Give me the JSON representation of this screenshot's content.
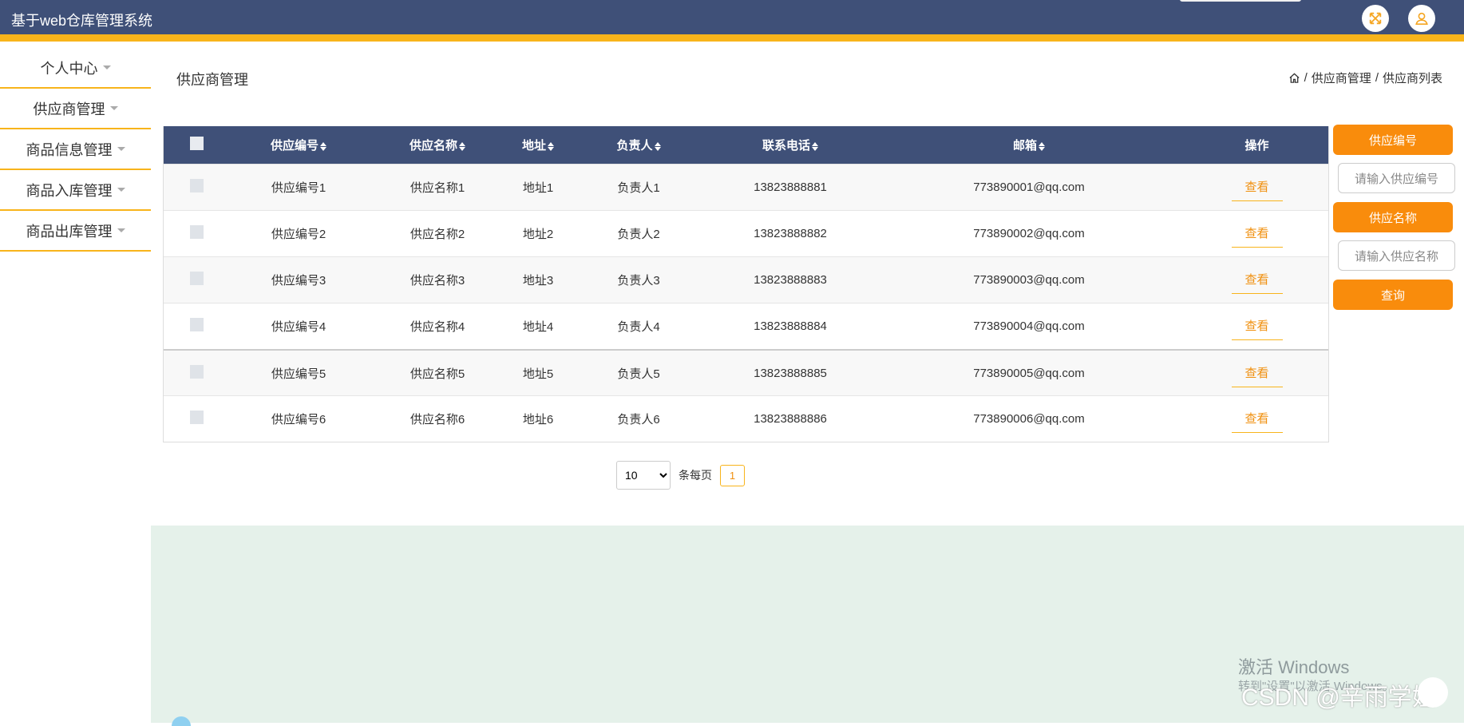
{
  "app": {
    "title": "基于web仓库管理系统"
  },
  "sidebar": {
    "items": [
      {
        "label": "个人中心"
      },
      {
        "label": "供应商管理"
      },
      {
        "label": "商品信息管理"
      },
      {
        "label": "商品入库管理"
      },
      {
        "label": "商品出库管理"
      }
    ]
  },
  "page": {
    "title": "供应商管理"
  },
  "breadcrumb": {
    "level1": "供应商管理",
    "level2": "供应商列表",
    "separator": "/"
  },
  "table": {
    "headers": [
      "供应编号",
      "供应名称",
      "地址",
      "负责人",
      "联系电话",
      "邮箱",
      "操作"
    ],
    "rows": [
      [
        "供应编号1",
        "供应名称1",
        "地址1",
        "负责人1",
        "13823888881",
        "773890001@qq.com",
        "查看"
      ],
      [
        "供应编号2",
        "供应名称2",
        "地址2",
        "负责人2",
        "13823888882",
        "773890002@qq.com",
        "查看"
      ],
      [
        "供应编号3",
        "供应名称3",
        "地址3",
        "负责人3",
        "13823888883",
        "773890003@qq.com",
        "查看"
      ],
      [
        "供应编号4",
        "供应名称4",
        "地址4",
        "负责人4",
        "13823888884",
        "773890004@qq.com",
        "查看"
      ],
      [
        "供应编号5",
        "供应名称5",
        "地址5",
        "负责人5",
        "13823888885",
        "773890005@qq.com",
        "查看"
      ],
      [
        "供应编号6",
        "供应名称6",
        "地址6",
        "负责人6",
        "13823888886",
        "773890006@qq.com",
        "查看"
      ]
    ]
  },
  "pagination": {
    "page_size": "10",
    "per_page_label": "条每页",
    "current_page": "1"
  },
  "search": {
    "code_label": "供应编号",
    "code_placeholder": "请输入供应编号",
    "name_label": "供应名称",
    "name_placeholder": "请输入供应名称",
    "query_button": "查询"
  },
  "watermarks": {
    "windows": "激活 Windows",
    "windows_sub": "转到\"设置\"以激活 Windows。",
    "csdn": "CSDN @辛雨学姐"
  },
  "icons": {
    "fullscreen": "fullscreen-icon",
    "user": "user-icon",
    "home": "home-icon"
  },
  "colors": {
    "header": "#3f5078",
    "accent": "#f8b41b",
    "button": "#f98c0c",
    "footer": "#e5f1ea"
  }
}
